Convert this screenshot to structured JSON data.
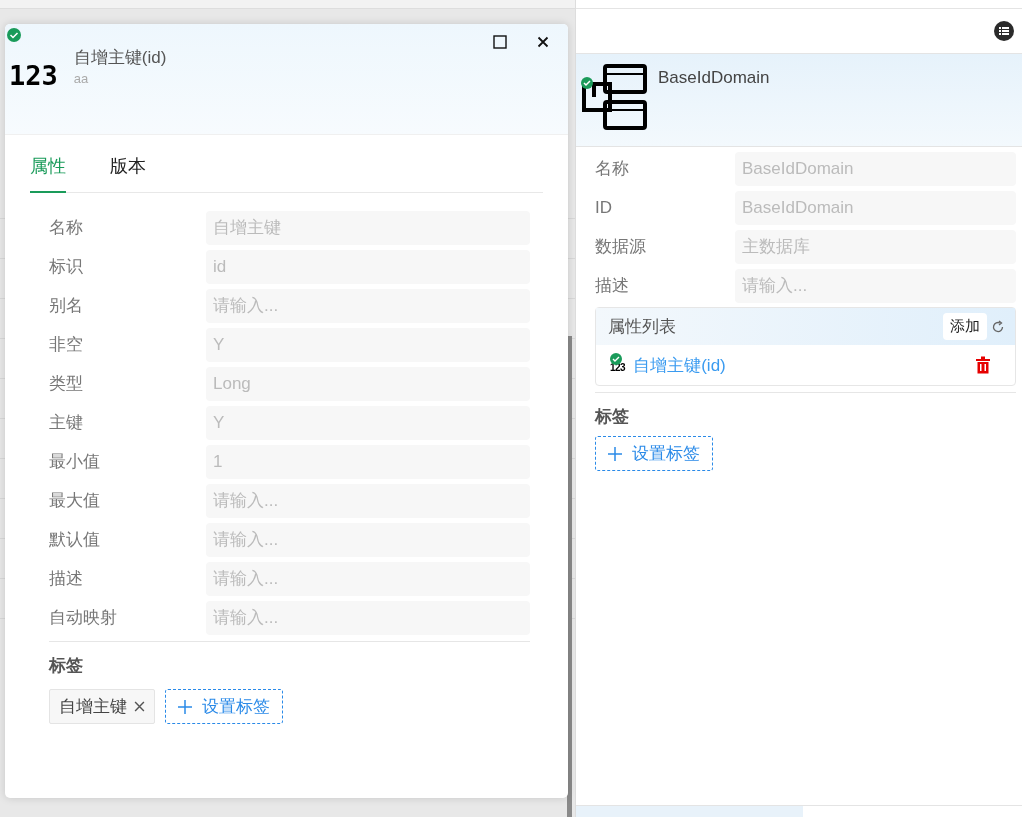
{
  "panel": {
    "title": "BaseIdDomain",
    "fields": [
      {
        "label": "名称",
        "value": "BaseIdDomain"
      },
      {
        "label": "ID",
        "value": "BaseIdDomain"
      },
      {
        "label": "数据源",
        "value": "主数据库"
      },
      {
        "label": "描述",
        "placeholder": "请输入..."
      }
    ],
    "attributes": {
      "title": "属性列表",
      "add": "添加",
      "items": [
        {
          "icon_text": "123",
          "name": "自增主键(id)"
        }
      ]
    },
    "tags_heading": "标签",
    "add_tag": "设置标签"
  },
  "dialog": {
    "icon_text": "123",
    "title": "自增主键(id)",
    "subtitle": "aa",
    "tabs": [
      {
        "label": "属性",
        "selected": true
      },
      {
        "label": "版本",
        "selected": false
      }
    ],
    "fields": [
      {
        "label": "名称",
        "value": "自增主键"
      },
      {
        "label": "标识",
        "value": "id"
      },
      {
        "label": "别名",
        "placeholder": "请输入..."
      },
      {
        "label": "非空",
        "value": "Y"
      },
      {
        "label": "类型",
        "value": "Long"
      },
      {
        "label": "主键",
        "value": "Y"
      },
      {
        "label": "最小值",
        "value": "1"
      },
      {
        "label": "最大值",
        "placeholder": "请输入..."
      },
      {
        "label": "默认值",
        "placeholder": "请输入..."
      },
      {
        "label": "描述",
        "placeholder": "请输入..."
      },
      {
        "label": "自动映射",
        "placeholder": "请输入..."
      }
    ],
    "tags_heading": "标签",
    "tags": [
      {
        "label": "自增主键"
      }
    ],
    "add_tag": "设置标签"
  }
}
